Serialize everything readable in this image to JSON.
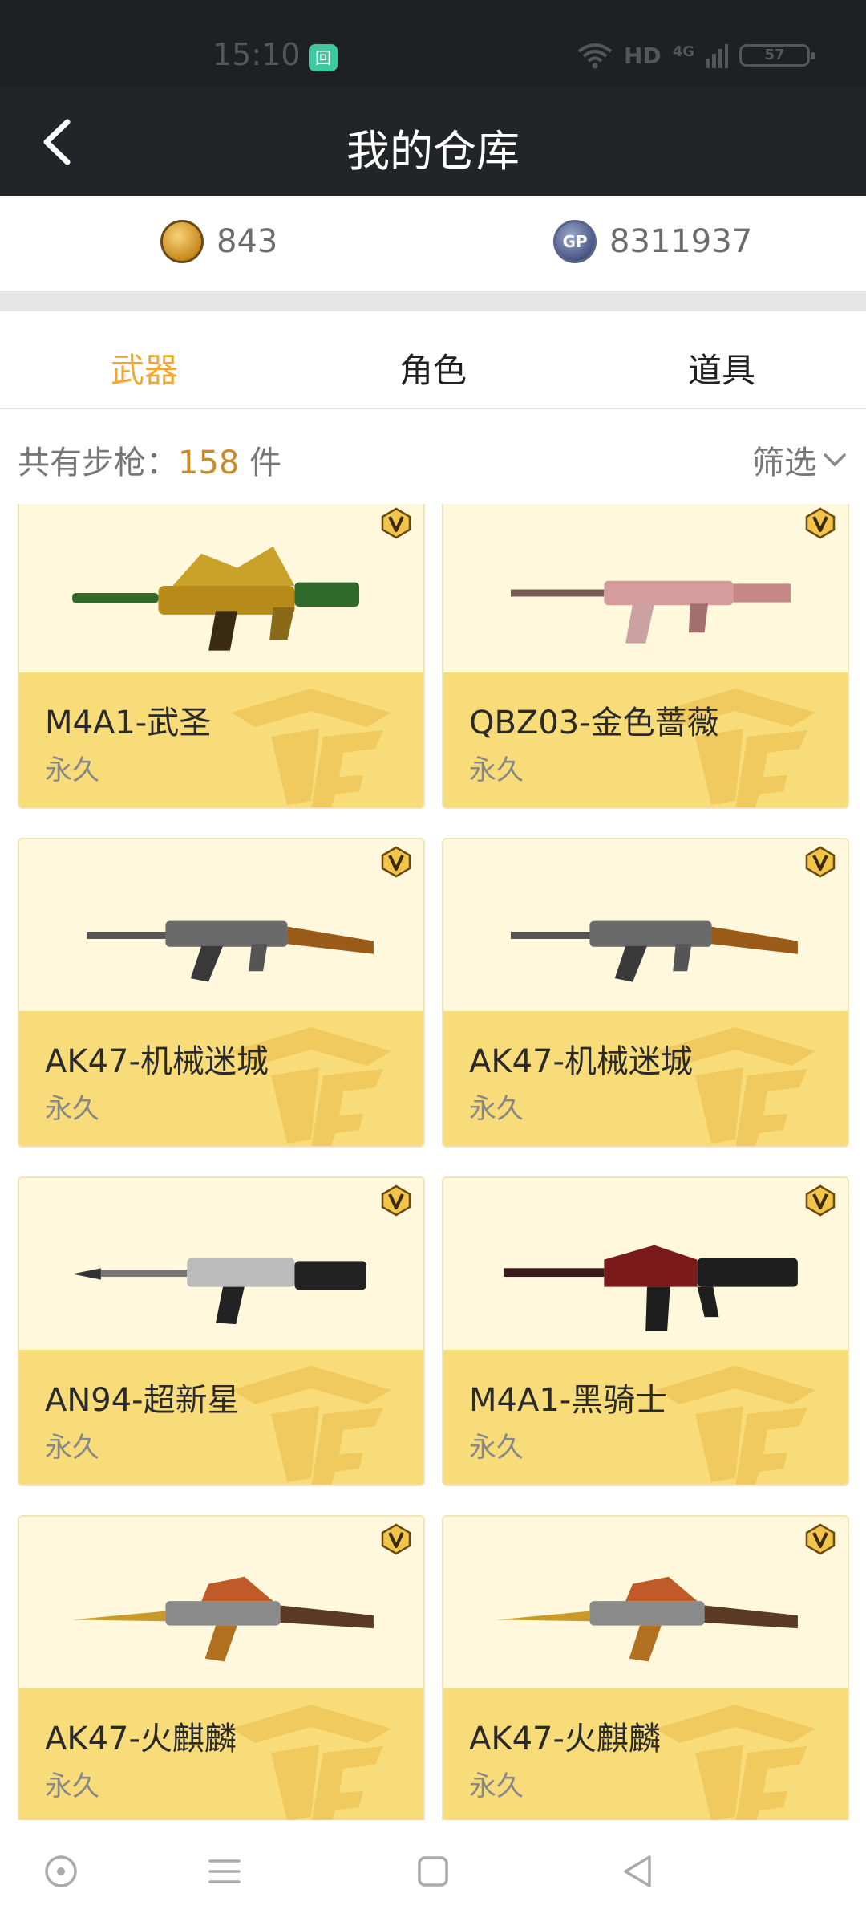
{
  "status_bar": {
    "time": "15:10",
    "app_badge": "回",
    "network": "HD",
    "cell": "4G",
    "battery": "57"
  },
  "header": {
    "title": "我的仓库"
  },
  "currency": {
    "cf_points": "843",
    "gp_points": "8311937",
    "gp_label": "GP"
  },
  "tabs": [
    {
      "label": "武器",
      "active": true
    },
    {
      "label": "角色",
      "active": false
    },
    {
      "label": "道具",
      "active": false
    }
  ],
  "summary": {
    "prefix": "共有步枪：",
    "count": "158",
    "suffix": " 件",
    "filter_label": "筛选"
  },
  "items": [
    {
      "name": "M4A1-武圣",
      "duration": "永久"
    },
    {
      "name": "QBZ03-金色蔷薇",
      "duration": "永久"
    },
    {
      "name": "AK47-机械迷城",
      "duration": "永久"
    },
    {
      "name": "AK47-机械迷城",
      "duration": "永久"
    },
    {
      "name": "AN94-超新星",
      "duration": "永久"
    },
    {
      "name": "M4A1-黑骑士",
      "duration": "永久"
    },
    {
      "name": "AK47-火麒麟",
      "duration": "永久"
    },
    {
      "name": "AK47-火麒麟",
      "duration": "永久"
    }
  ],
  "colors": {
    "accent": "#f0a832",
    "card_bottom": "#f8dc7a",
    "card_top": "#fff8dc",
    "header_bg": "#232427"
  }
}
